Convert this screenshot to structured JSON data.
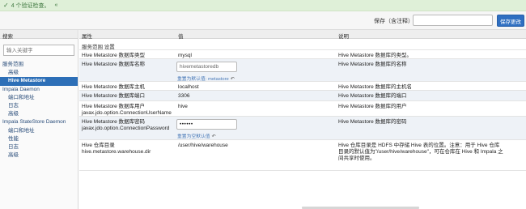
{
  "notice": {
    "text": "4 个验证检查。",
    "collapse": "«"
  },
  "savebar": {
    "label": "保存（含注释）",
    "input_value": "",
    "save_button": "保存更改"
  },
  "sidebar": {
    "header": "搜索",
    "search_placeholder": "输入关键字",
    "items": [
      {
        "label": "服务范围",
        "kind": "group"
      },
      {
        "label": "高级",
        "kind": "item"
      },
      {
        "label": "Hive Metastore",
        "kind": "item",
        "active": true
      },
      {
        "label": "Impala Daemon",
        "kind": "group"
      },
      {
        "label": "端口和地址",
        "kind": "item"
      },
      {
        "label": "日志",
        "kind": "item"
      },
      {
        "label": "高级",
        "kind": "item"
      },
      {
        "label": "Impala StateStore Daemon",
        "kind": "group"
      },
      {
        "label": "端口和地址",
        "kind": "item"
      },
      {
        "label": "性能",
        "kind": "item"
      },
      {
        "label": "日志",
        "kind": "item"
      },
      {
        "label": "高级",
        "kind": "item"
      }
    ]
  },
  "table": {
    "headers": {
      "property": "属性",
      "value": "值",
      "description": "说明"
    },
    "section": "服务范围 设置",
    "reset_label": "重置为默认值: metastore",
    "reset_label_short": "重置为空默认值",
    "undo_icon": "↶",
    "rows": [
      {
        "property": "Hive Metastore 数据库类型",
        "value": "mysql",
        "description": "Hive Metastore 数据库的类型。"
      },
      {
        "property": "Hive Metastore 数据库名称",
        "value": "hivemetastoredb",
        "description": "Hive Metastore 数据库的名称"
      },
      {
        "property": "Hive Metastore 数据库主机",
        "value": "localhost",
        "description": "Hive Metastore 数据库的主机名"
      },
      {
        "property": "Hive Metastore 数据库端口",
        "value": "3306",
        "description": "Hive Metastore 数据库的端口"
      },
      {
        "property": "Hive Metastore 数据库用户",
        "property2": "javax.jdo.option.ConnectionUserName",
        "value": "hive",
        "description": "Hive Metastore 数据库的用户"
      },
      {
        "property": "Hive Metastore 数据库密码",
        "property2": "javax.jdo.option.ConnectionPassword",
        "value": "••••••",
        "description": "Hive Metastore 数据库的密码"
      },
      {
        "property": "Hive 仓库目录",
        "property2": "hive.metastore.warehouse.dir",
        "value": "/user/hive/warehouse",
        "description": "Hive 仓库目录是 HDFS 中存储 Hive 表的位置。注意：用于 Hive 仓库目录的默认值为\"/user/hive/warehouse\"，可在仓库在 Hive 和 Impala 之间共享时使用。"
      }
    ]
  }
}
